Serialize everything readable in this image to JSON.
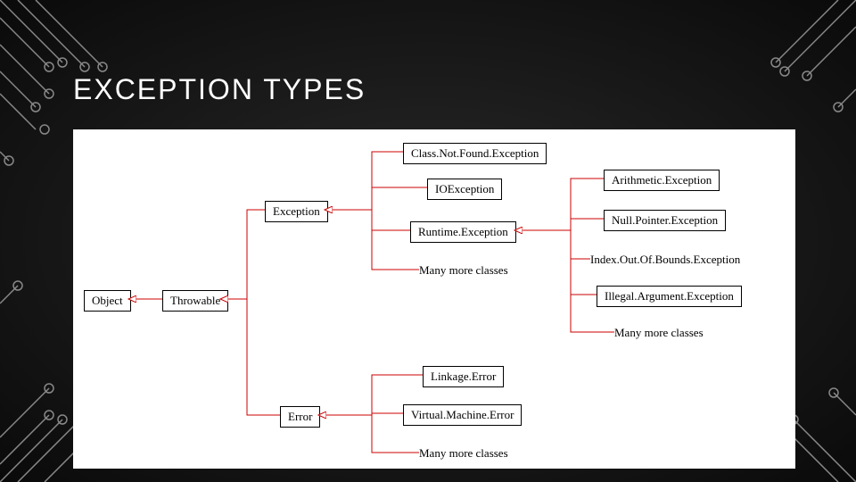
{
  "title": "EXCEPTION TYPES",
  "nodes": {
    "object": "Object",
    "throwable": "Throwable",
    "exception": "Exception",
    "error": "Error",
    "classnotfound": "Class.Not.Found.Exception",
    "ioexception": "IOException",
    "runtime": "Runtime.Exception",
    "manymore1": "Many more classes",
    "linkage": "Linkage.Error",
    "vmerror": "Virtual.Machine.Error",
    "manymore2": "Many more classes",
    "arithmetic": "Arithmetic.Exception",
    "nullpointer": "Null.Pointer.Exception",
    "indexoob": "Index.Out.Of.Bounds.Exception",
    "illegalarg": "Illegal.Argument.Exception",
    "manymore3": "Many more classes"
  }
}
